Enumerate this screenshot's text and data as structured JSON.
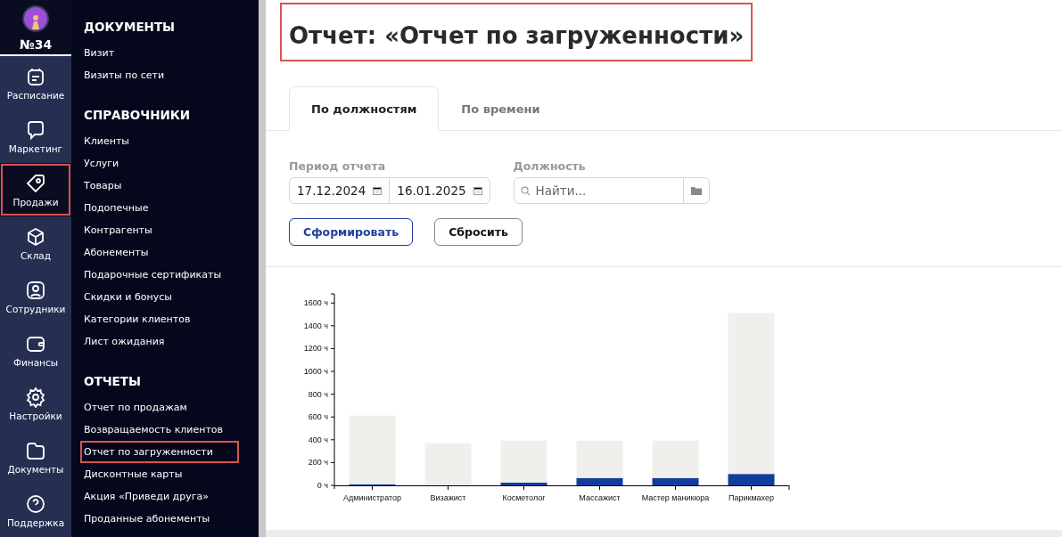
{
  "account": {
    "number": "№34"
  },
  "rail": [
    {
      "label": "Расписание",
      "selected": false,
      "highlighted": false
    },
    {
      "label": "Маркетинг",
      "selected": false,
      "highlighted": false
    },
    {
      "label": "Продажи",
      "selected": true,
      "highlighted": true
    },
    {
      "label": "Склад",
      "selected": false,
      "highlighted": false
    },
    {
      "label": "Сотрудники",
      "selected": false,
      "highlighted": false
    },
    {
      "label": "Финансы",
      "selected": false,
      "highlighted": false
    },
    {
      "label": "Настройки",
      "selected": false,
      "highlighted": false
    },
    {
      "label": "Документы",
      "selected": false,
      "highlighted": false
    },
    {
      "label": "Поддержка",
      "selected": false,
      "highlighted": false
    }
  ],
  "menu": [
    {
      "heading": "ДОКУМЕНТЫ",
      "items": [
        {
          "label": "Визит",
          "highlighted": false
        },
        {
          "label": "Визиты по сети",
          "highlighted": false
        }
      ]
    },
    {
      "heading": "СПРАВОЧНИКИ",
      "items": [
        {
          "label": "Клиенты",
          "highlighted": false
        },
        {
          "label": "Услуги",
          "highlighted": false
        },
        {
          "label": "Товары",
          "highlighted": false
        },
        {
          "label": "Подопечные",
          "highlighted": false
        },
        {
          "label": "Контрагенты",
          "highlighted": false
        },
        {
          "label": "Абонементы",
          "highlighted": false
        },
        {
          "label": "Подарочные сертификаты",
          "highlighted": false
        },
        {
          "label": "Скидки и бонусы",
          "highlighted": false
        },
        {
          "label": "Категории клиентов",
          "highlighted": false
        },
        {
          "label": "Лист ожидания",
          "highlighted": false
        }
      ]
    },
    {
      "heading": "ОТЧЕТЫ",
      "items": [
        {
          "label": "Отчет по продажам",
          "highlighted": false
        },
        {
          "label": "Возвращаемость клиентов",
          "highlighted": false
        },
        {
          "label": "Отчет по загруженности",
          "highlighted": true
        },
        {
          "label": "Дисконтные карты",
          "highlighted": false
        },
        {
          "label": "Акция «Приведи друга»",
          "highlighted": false
        },
        {
          "label": "Проданные абонементы",
          "highlighted": false
        }
      ]
    }
  ],
  "page": {
    "title": "Отчет: «Отчет по загруженности»",
    "title_highlighted": true
  },
  "tabs": [
    {
      "label": "По должностям",
      "selected": true
    },
    {
      "label": "По времени",
      "selected": false
    }
  ],
  "filters": {
    "period_label": "Период отчета",
    "date_from": "17.12.2024",
    "date_to": "16.01.2025",
    "position_label": "Должность",
    "position_placeholder": "Найти..."
  },
  "buttons": [
    {
      "label": "Сформировать",
      "kind": "primary"
    },
    {
      "label": "Сбросить",
      "kind": "secondary"
    }
  ],
  "chart_data": {
    "type": "bar",
    "stacked": true,
    "categories": [
      "Администратор",
      "Визажист",
      "Косметолог",
      "Массажист",
      "Мастер маникюра",
      "Парикмахер"
    ],
    "series": [
      {
        "color": "#143c9c",
        "values": [
          10,
          0,
          25,
          65,
          65,
          100
        ]
      },
      {
        "color": "#f1efec",
        "values": [
          610,
          370,
          375,
          335,
          335,
          1420
        ]
      }
    ],
    "ylim": [
      0,
      1680
    ],
    "yticks": [
      {
        "value": 0,
        "label": "0 ч"
      },
      {
        "value": 200,
        "label": "200 ч"
      },
      {
        "value": 400,
        "label": "400 ч"
      },
      {
        "value": 600,
        "label": "600 ч"
      },
      {
        "value": 800,
        "label": "800 ч"
      },
      {
        "value": 1000,
        "label": "1000 ч"
      },
      {
        "value": 1200,
        "label": "1200 ч"
      },
      {
        "value": 1400,
        "label": "1400 ч"
      },
      {
        "value": 1600,
        "label": "1600 ч"
      }
    ]
  }
}
